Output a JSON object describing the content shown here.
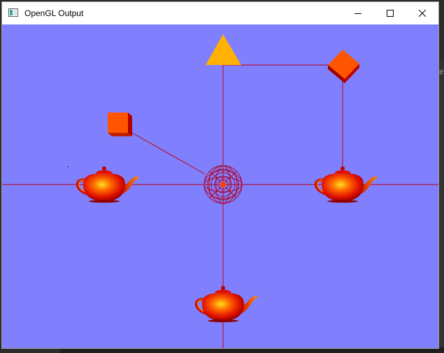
{
  "window": {
    "title": "OpenGL Output",
    "controls": [
      "minimize",
      "maximize",
      "close"
    ]
  },
  "background_peek": "e",
  "scene": {
    "background_color": "#8080ff",
    "line_color": "#c00010",
    "objects": [
      {
        "name": "teapot-left",
        "shape": "teapot",
        "color": "#e01000"
      },
      {
        "name": "teapot-right",
        "shape": "teapot",
        "color": "#e01000"
      },
      {
        "name": "teapot-bottom",
        "shape": "teapot",
        "color": "#e01000"
      },
      {
        "name": "wire-sphere-center",
        "shape": "wire-sphere",
        "color": "#b00020"
      },
      {
        "name": "triangle-top",
        "shape": "triangle",
        "color": "#ffb000"
      },
      {
        "name": "cube-left",
        "shape": "cube",
        "color": "#ff5500"
      },
      {
        "name": "cube-top-right",
        "shape": "cube",
        "color": "#ff5500"
      }
    ]
  }
}
